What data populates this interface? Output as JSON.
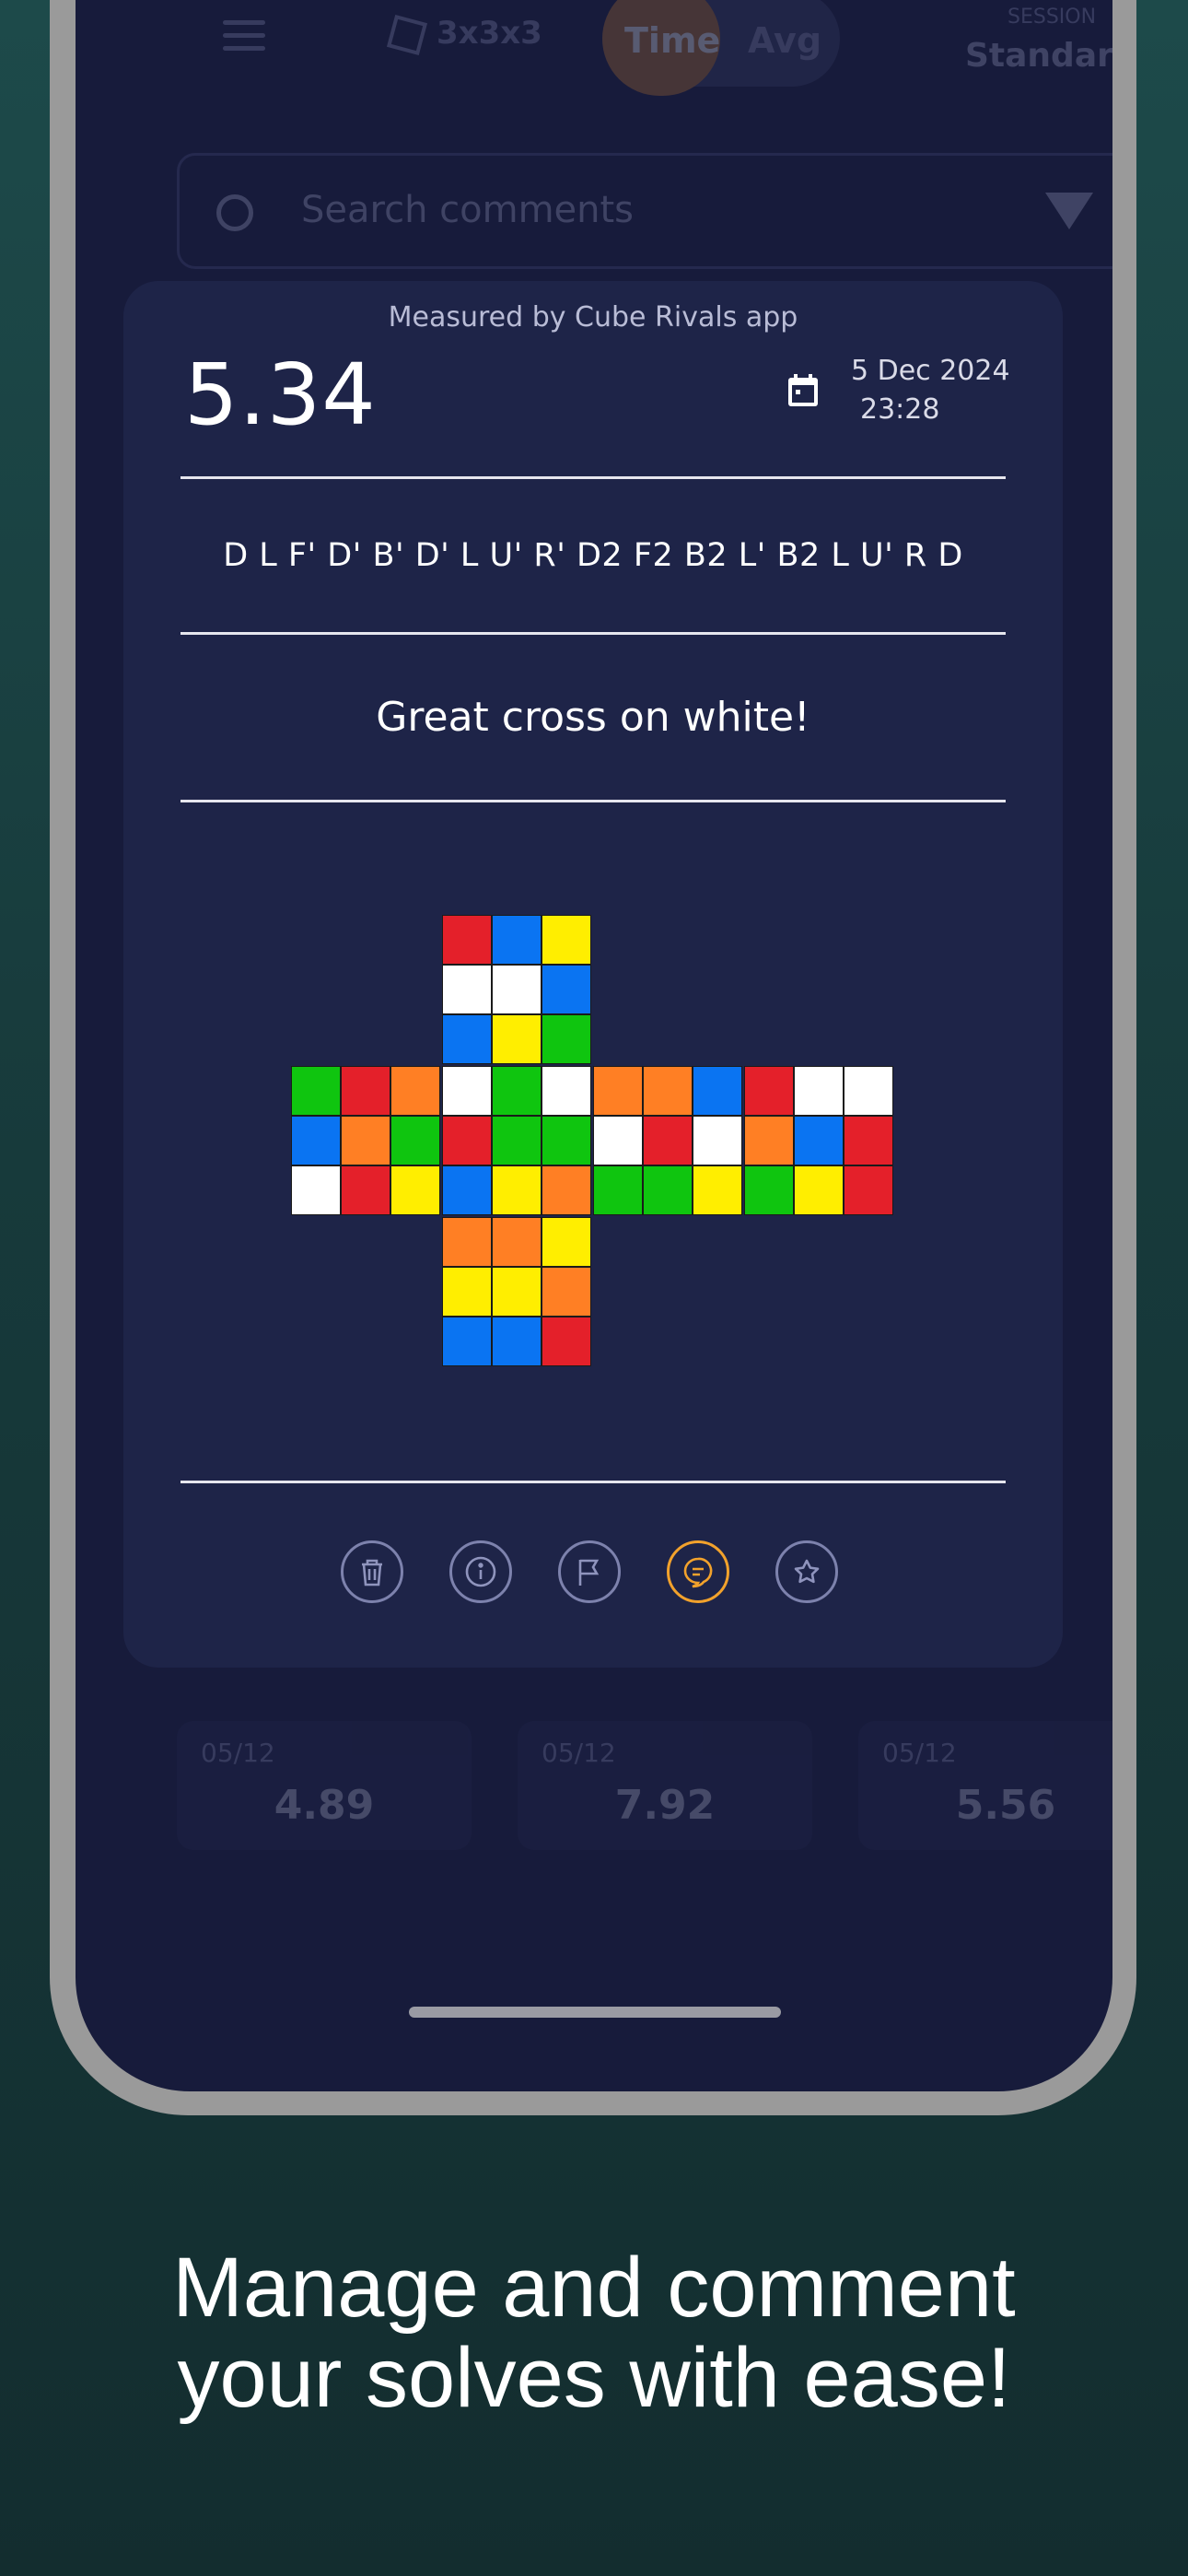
{
  "header": {
    "puzzle": "3x3x3",
    "mode_time": "Time",
    "mode_avg": "Avg",
    "session_label": "SESSION",
    "session_value": "Standard"
  },
  "search": {
    "placeholder": "Search comments"
  },
  "background_solves": [
    {
      "date": "05/12",
      "time": "4.89"
    },
    {
      "date": "05/12",
      "time": "7.92"
    },
    {
      "date": "05/12",
      "time": "5.56"
    }
  ],
  "solve_card": {
    "measured_by": "Measured by Cube Rivals app",
    "time": "5.34",
    "date": "5 Dec 2024",
    "clock": "23:28",
    "scramble": "D L F' D' B' D' L U' R' D2 F2 B2 L' B2 L U' R D",
    "comment": "Great cross on white!",
    "cube_net": {
      "colors": {
        "W": "#ffffff",
        "Y": "#ffee00",
        "R": "#e4202a",
        "O": "#ff7f24",
        "G": "#0fc50f",
        "B": "#0a74f2"
      },
      "U": [
        "R",
        "B",
        "Y",
        "W",
        "W",
        "B",
        "B",
        "Y",
        "G"
      ],
      "L": [
        "G",
        "R",
        "O",
        "B",
        "O",
        "G",
        "W",
        "R",
        "Y"
      ],
      "F": [
        "W",
        "G",
        "W",
        "R",
        "G",
        "G",
        "B",
        "Y",
        "O"
      ],
      "R": [
        "O",
        "O",
        "B",
        "W",
        "R",
        "W",
        "G",
        "G",
        "Y"
      ],
      "B": [
        "R",
        "W",
        "W",
        "O",
        "B",
        "R",
        "G",
        "Y",
        "R"
      ],
      "D": [
        "O",
        "O",
        "Y",
        "Y",
        "Y",
        "O",
        "B",
        "B",
        "R"
      ]
    },
    "actions": [
      {
        "name": "delete",
        "icon": "trash-icon",
        "active": false
      },
      {
        "name": "info",
        "icon": "info-icon",
        "active": false
      },
      {
        "name": "flag",
        "icon": "flag-icon",
        "active": false
      },
      {
        "name": "comment",
        "icon": "comment-icon",
        "active": true
      },
      {
        "name": "favorite",
        "icon": "star-icon",
        "active": false
      }
    ],
    "accent": "#f2a22c"
  },
  "tagline": {
    "line1": "Manage and comment",
    "line2": "your solves with ease!"
  }
}
